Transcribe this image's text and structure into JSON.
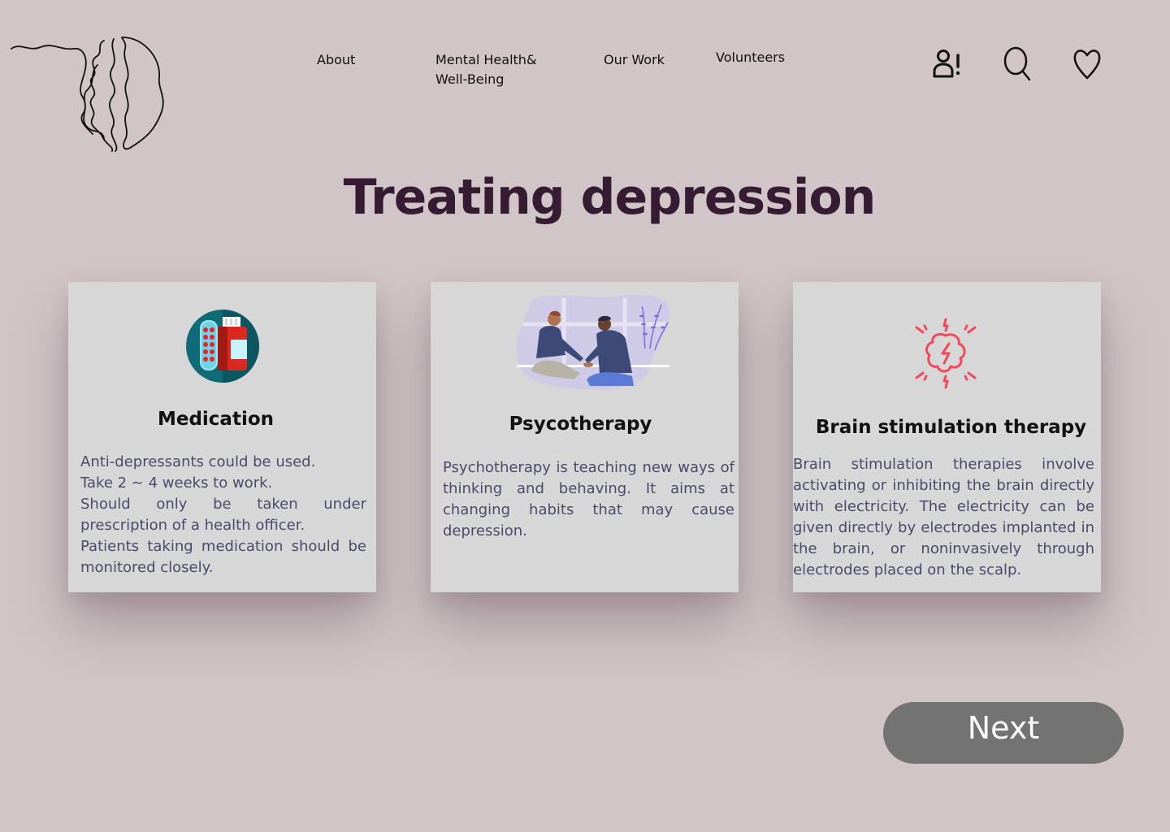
{
  "nav": {
    "about": "About",
    "mental_health": "Mental Health& Well-Being",
    "our_work": "Our Work",
    "volunteers": "Volunteers"
  },
  "icons": {
    "logo": "brain-line-logo",
    "user": "user-alert-icon",
    "search": "search-icon",
    "favorites": "heart-icon"
  },
  "page": {
    "title": "Treating depression"
  },
  "cards": [
    {
      "title": "Medication",
      "icon": "pills-bottle-icon",
      "text": "Anti-depressants could be used.\nTake 2 ~ 4 weeks to work.\nShould only be taken under prescription of a health officer.\nPatients taking medication should be monitored closely."
    },
    {
      "title": "Psycotherapy",
      "icon": "therapy-session-illustration",
      "text": "Psychotherapy is teaching new ways of thinking and behaving. It aims at changing habits that may cause depression."
    },
    {
      "title": "Brain stimulation therapy",
      "icon": "brain-electricity-icon",
      "text": "Brain stimulation therapies involve activating or inhibiting the brain directly with electricity. The electricity can be given directly by electrodes implanted in the brain, or noninvasively through electrodes placed on the scalp."
    }
  ],
  "actions": {
    "next": "Next"
  },
  "colors": {
    "background": "#d1c5c7",
    "title": "#351c33",
    "card": "#d8d7d7",
    "body_text": "#4a4a6a",
    "button": "#737373",
    "accent_red": "#f04a5a"
  }
}
